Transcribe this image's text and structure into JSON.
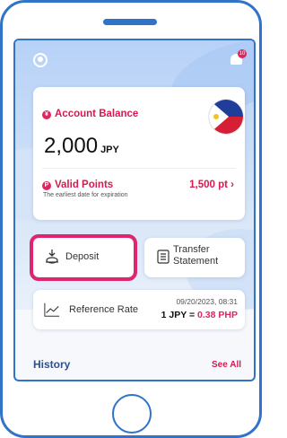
{
  "header": {
    "notification_count": "10"
  },
  "account": {
    "label": "Account Balance",
    "balance": "2,000",
    "currency": "JPY",
    "country_flag": "philippines-flag"
  },
  "points": {
    "label": "Valid Points",
    "subtitle": "The earliest date for expiration",
    "value": "1,500 pt"
  },
  "actions": {
    "deposit_label": "Deposit",
    "transfer_label_line1": "Transfer",
    "transfer_label_line2": "Statement"
  },
  "reference_rate": {
    "label": "Reference Rate",
    "datetime": "09/20/2023, 08:31",
    "rate_prefix": "1 JPY = ",
    "rate_value": "0.38 PHP"
  },
  "history": {
    "title": "History",
    "see_all": "See All"
  },
  "colors": {
    "accent": "#d31b50",
    "frame": "#2f74c9",
    "highlight": "#e0256f"
  }
}
